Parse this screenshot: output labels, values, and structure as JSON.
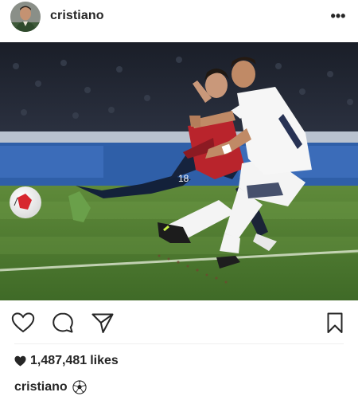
{
  "post": {
    "username": "cristiano",
    "more_label": "•••"
  },
  "photo": {
    "description_icon": "soccer-photo",
    "jersey_number": "18"
  },
  "actions": {
    "like_icon": "heart-outline-icon",
    "comment_icon": "comment-bubble-icon",
    "share_icon": "paper-plane-icon",
    "save_icon": "bookmark-icon"
  },
  "likes": {
    "count": "1,487,481",
    "suffix": "likes",
    "icon": "heart-filled-icon"
  },
  "caption": {
    "username": "cristiano",
    "emoji_icon": "soccer-ball-icon"
  },
  "colors": {
    "text": "#262626",
    "divider": "#efefef",
    "pitch": "#4f7a2f",
    "stands": "#1b2330"
  }
}
